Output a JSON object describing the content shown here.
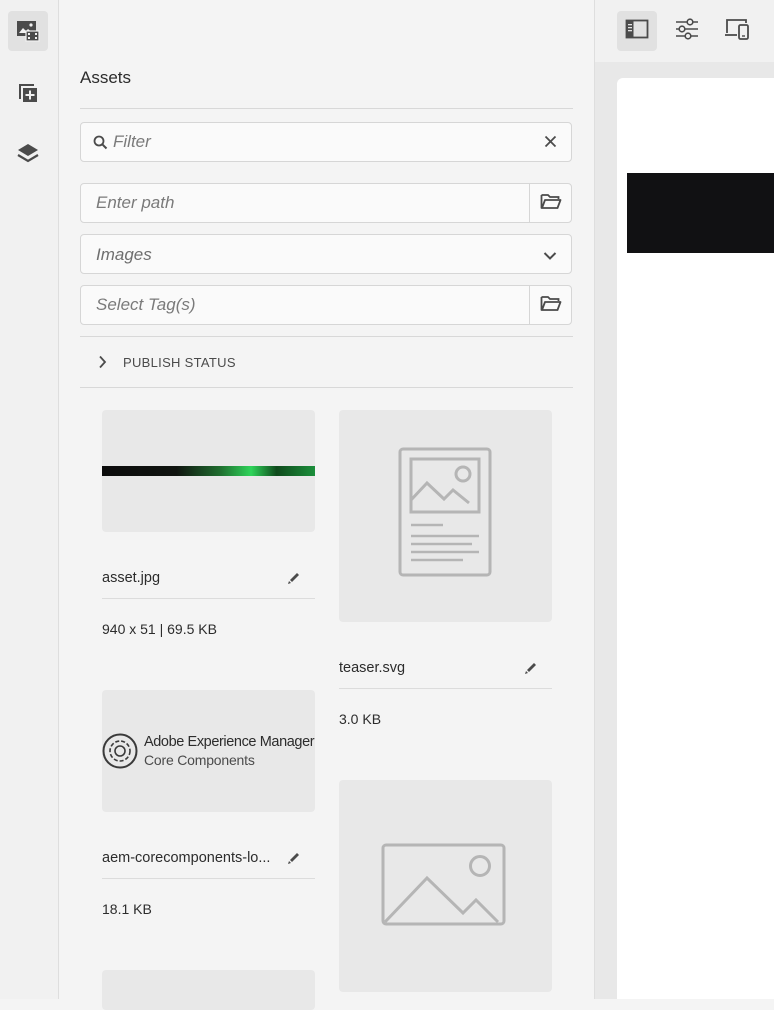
{
  "rail": {
    "items": [
      {
        "icon": "asset-finder-icon",
        "active": true
      },
      {
        "icon": "components-icon",
        "active": false
      },
      {
        "icon": "layers-icon",
        "active": false
      }
    ]
  },
  "panel": {
    "title": "Assets",
    "filter": {
      "placeholder": "Filter"
    },
    "path": {
      "placeholder": "Enter path"
    },
    "type_select": {
      "value": "Images"
    },
    "tags": {
      "placeholder": "Select Tag(s)"
    },
    "publish_status": {
      "label": "PUBLISH STATUS"
    }
  },
  "assets": [
    {
      "name": "asset.jpg",
      "meta": "940 x 51 | 69.5 KB"
    },
    {
      "name": "teaser.svg",
      "meta": "3.0 KB"
    },
    {
      "name": "aem-corecomponents-lo...",
      "meta": "18.1 KB",
      "logo": {
        "line1": "Adobe Experience Manager",
        "line2": "Core Components"
      }
    },
    {
      "name": "",
      "meta": ""
    },
    {
      "name": "",
      "meta": ""
    }
  ],
  "toolbar": {
    "items": [
      {
        "icon": "side-panel-icon",
        "active": true
      },
      {
        "icon": "properties-icon",
        "active": false
      },
      {
        "icon": "emulator-icon",
        "active": false
      }
    ]
  }
}
